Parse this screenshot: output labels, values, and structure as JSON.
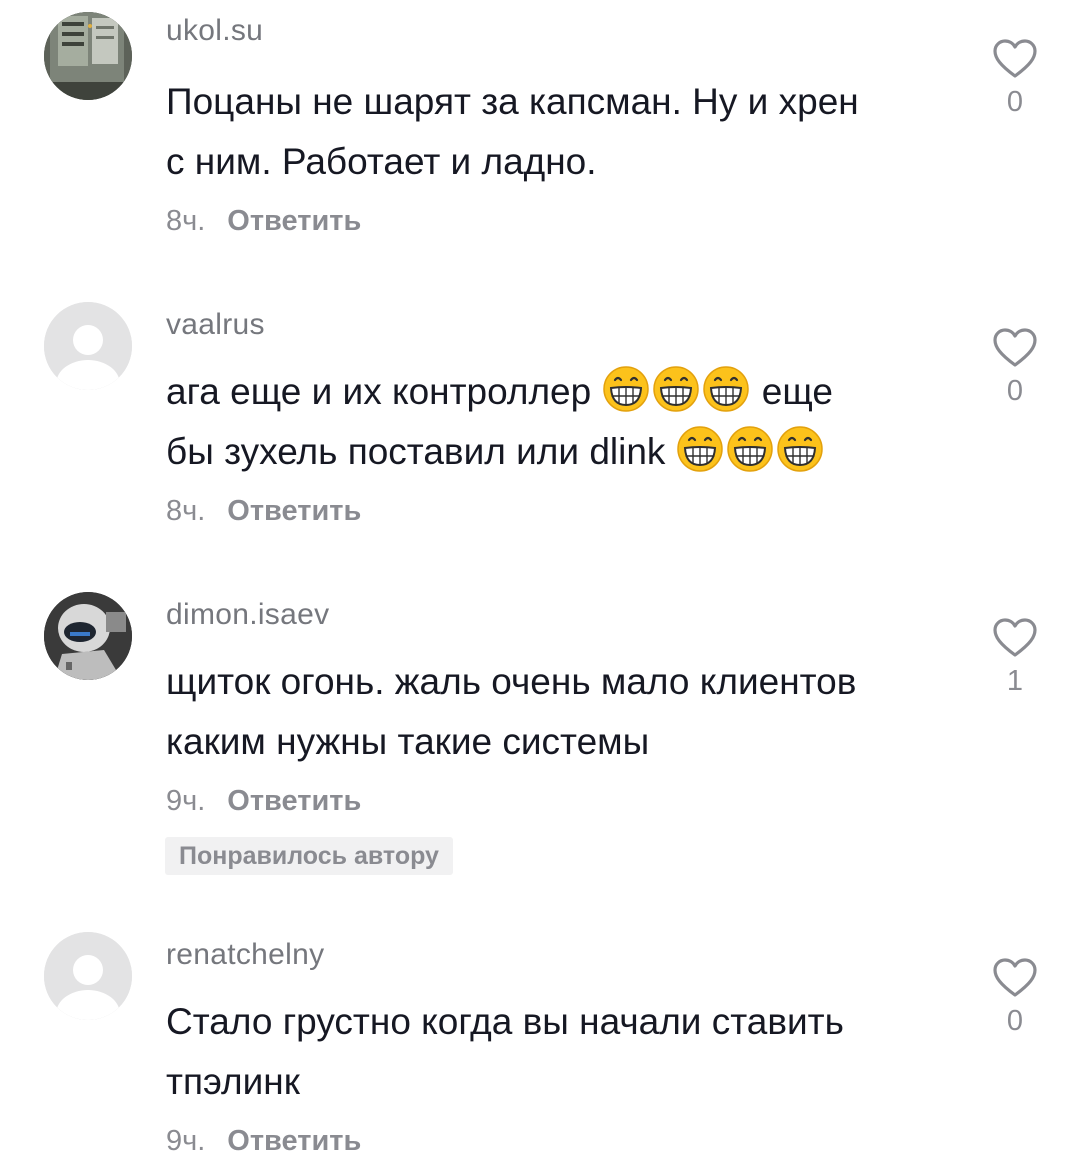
{
  "comments": [
    {
      "username": "ukol.su",
      "text_lines": [
        "Поцаны не шарят за капсман. Ну и хрен",
        "с ним. Работает и ладно."
      ],
      "time": "8ч.",
      "reply_label": "Ответить",
      "likes": "0",
      "avatar": "photo-server-rack"
    },
    {
      "username": "vaalrus",
      "line1_text": "ага еще и их контроллер",
      "line1_tail": "еще",
      "line2_text": "бы зухель поставил или dlink",
      "emoji": "grinning-face-with-smiling-eyes",
      "time": "8ч.",
      "reply_label": "Ответить",
      "likes": "0",
      "avatar": "default-avatar"
    },
    {
      "username": "dimon.isaev",
      "text_lines": [
        "щиток огонь. жаль очень мало клиентов",
        "каким нужны такие системы"
      ],
      "time": "9ч.",
      "reply_label": "Ответить",
      "likes": "1",
      "badge": "Понравилось автору",
      "avatar": "photo-person-helmet"
    },
    {
      "username": "renatchelny",
      "text_lines": [
        "Стало грустно когда вы начали ставить",
        "тпэлинк"
      ],
      "time": "9ч.",
      "reply_label": "Ответить",
      "likes": "0",
      "avatar": "default-avatar"
    }
  ],
  "colors": {
    "text": "#161823",
    "secondary": "#8a8b91",
    "username": "#75777d",
    "badge_bg": "#f1f1f2"
  }
}
